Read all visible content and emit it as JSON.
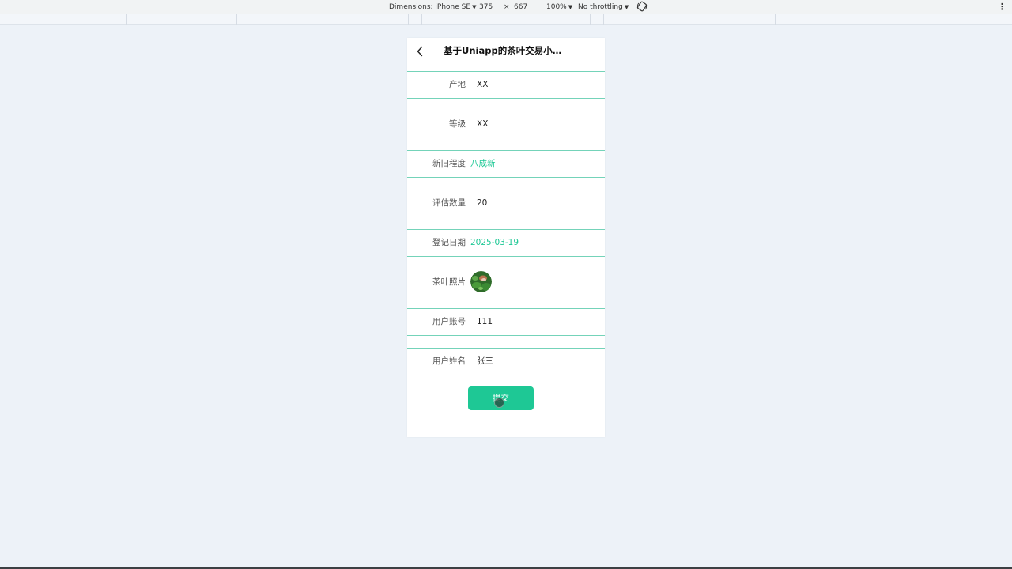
{
  "devtools": {
    "dimensions_label": "Dimensions: iPhone SE",
    "width": "375",
    "times": "×",
    "height": "667",
    "zoom": "100%",
    "throttling": "No throttling"
  },
  "app": {
    "title": "基于Uniapp的茶叶交易小程序...",
    "accent_color": "#1ec895",
    "row_border_color": "#74d3b9"
  },
  "form": {
    "fields": [
      {
        "label": "产地",
        "value": "XX",
        "kind": "input"
      },
      {
        "label": "等级",
        "value": "XX",
        "kind": "input"
      },
      {
        "label": "新旧程度",
        "value": "八成新",
        "kind": "picker"
      },
      {
        "label": "评估数量",
        "value": "20",
        "kind": "input"
      },
      {
        "label": "登记日期",
        "value": "2025-03-19",
        "kind": "picker"
      },
      {
        "label": "茶叶照片",
        "value": "",
        "kind": "image"
      },
      {
        "label": "用户账号",
        "value": "111",
        "kind": "input"
      },
      {
        "label": "用户姓名",
        "value": "张三",
        "kind": "input"
      }
    ],
    "submit_label": "提交"
  }
}
